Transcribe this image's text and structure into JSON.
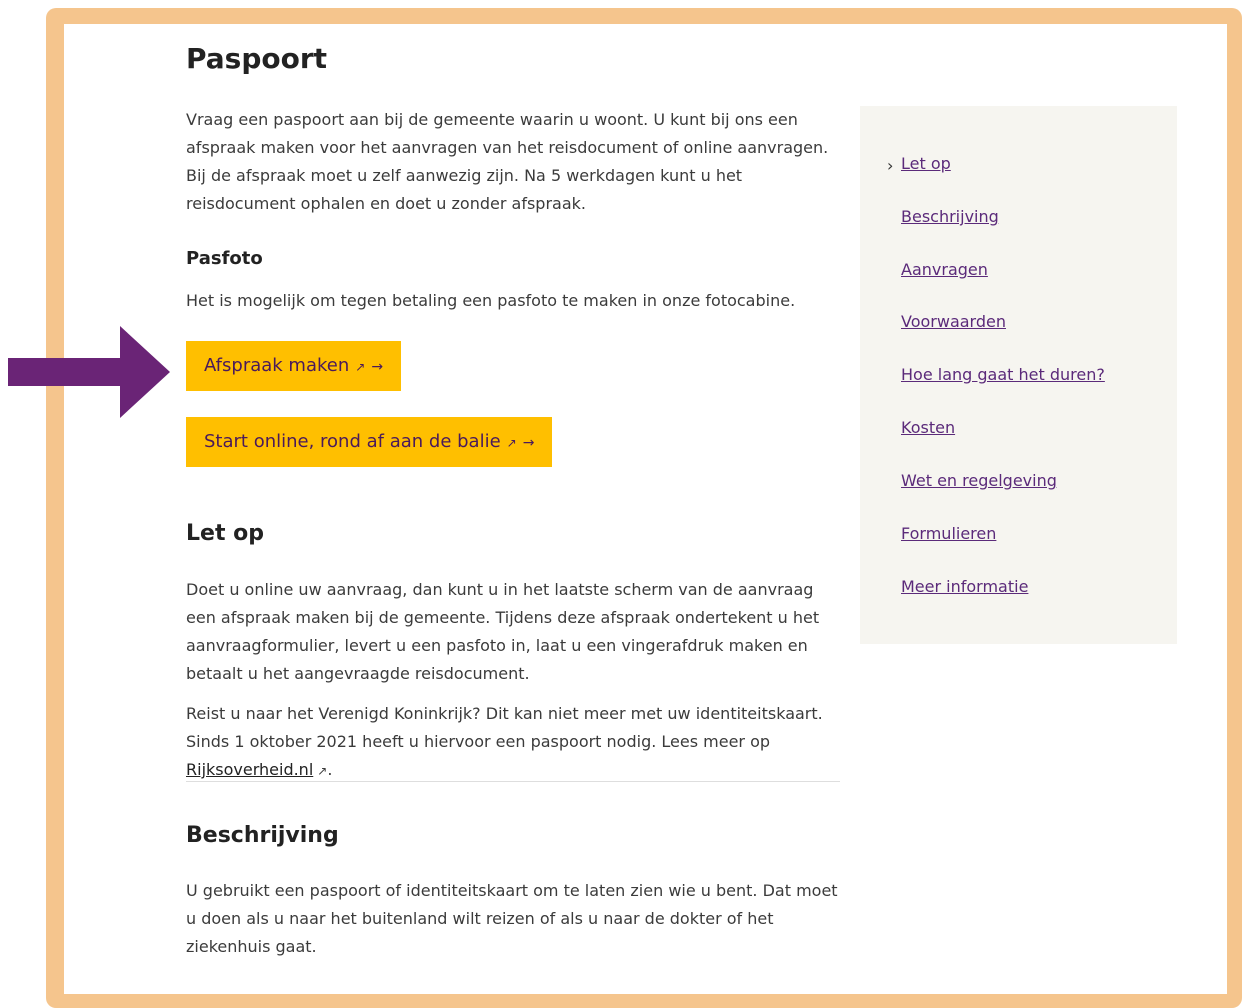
{
  "page": {
    "title": "Paspoort",
    "intro": "Vraag een paspoort aan bij de gemeente waarin u woont. U kunt bij ons een afspraak maken voor het aanvragen van het reisdocument of online aanvragen. Bij de afspraak moet u zelf aanwezig zijn. Na 5 werkdagen kunt u het reisdocument ophalen en doet u zonder afspraak.",
    "pasfoto": {
      "heading": "Pasfoto",
      "text": "Het is mogelijk om tegen betaling een pasfoto te maken in onze fotocabine."
    },
    "buttons": {
      "afspraak": "Afspraak maken",
      "online": "Start online, rond af aan de balie"
    },
    "letop": {
      "heading": "Let op",
      "paragraph1": "Doet u online uw aanvraag, dan kunt u in het laatste scherm van de aanvraag een afspraak maken bij de gemeente. Tijdens deze afspraak ondertekent u het aanvraagformulier, levert u een pasfoto in, laat u een vingerafdruk maken en betaalt u het aangevraagde reisdocument.",
      "paragraph2_before": "Reist u naar het Verenigd Koninkrijk? Dit kan niet meer met uw identiteitskaart. Sinds 1 oktober 2021 heeft u hiervoor een paspoort nodig. Lees meer op ",
      "paragraph2_link": "Rijksoverheid.nl",
      "paragraph2_after": "."
    },
    "beschrijving": {
      "heading": "Beschrijving",
      "text": "U gebruikt een paspoort of identiteitskaart om te laten zien wie u bent. Dat moet u doen als u naar het buitenland wilt reizen of als u naar de dokter of het ziekenhuis gaat."
    }
  },
  "sidebar": {
    "items": [
      {
        "label": "Let op"
      },
      {
        "label": "Beschrijving"
      },
      {
        "label": "Aanvragen"
      },
      {
        "label": "Voorwaarden"
      },
      {
        "label": "Hoe lang gaat het duren?"
      },
      {
        "label": "Kosten"
      },
      {
        "label": "Wet en regelgeving"
      },
      {
        "label": "Formulieren"
      },
      {
        "label": "Meer informatie"
      }
    ]
  },
  "icons": {
    "external": "external-link-icon",
    "arrow": "arrow-right-icon",
    "chevron": "chevron-right-icon",
    "annotation": "purple-pointer-arrow"
  },
  "colors": {
    "frame": "#f5c58d",
    "button": "#ffbf00",
    "button_text": "#4a1a5b",
    "link": "#5b2a7a",
    "sidebar_bg": "#f6f5f0",
    "annotation_arrow": "#6a2476"
  }
}
